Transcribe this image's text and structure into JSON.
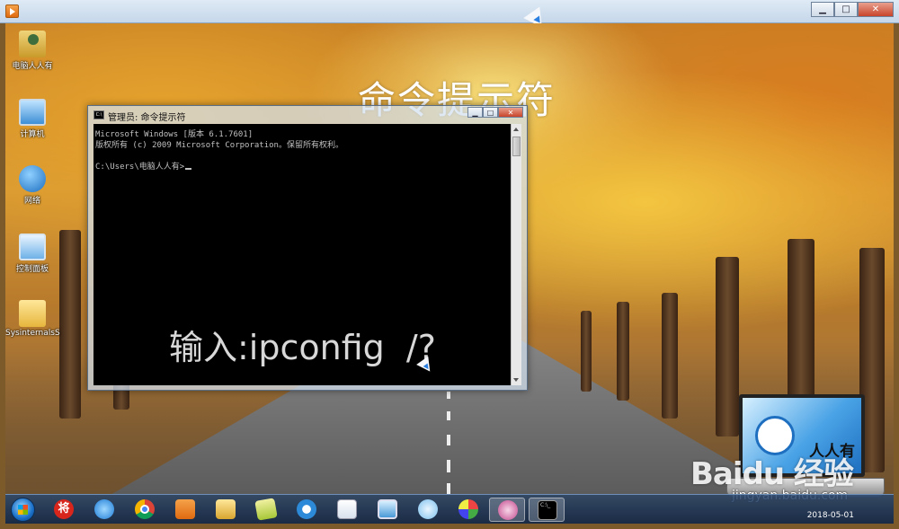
{
  "outer_window": {
    "minimize_symbol": "▁",
    "maximize_symbol": "□",
    "close_symbol": "✕"
  },
  "overlay": {
    "title": "命令提示符",
    "instruction": "输入:ipconfig  /?"
  },
  "desktop_icons": [
    {
      "label": "电脑人人有",
      "icon": "user-folder-icon"
    },
    {
      "label": "计算机",
      "icon": "computer-icon"
    },
    {
      "label": "网络",
      "icon": "network-icon"
    },
    {
      "label": "控制面板",
      "icon": "control-panel-icon"
    },
    {
      "label": "SysinternalsS",
      "icon": "folder-icon"
    }
  ],
  "cmd_window": {
    "title": "管理员: 命令提示符",
    "icon_text": "C:\\",
    "lines": [
      "Microsoft Windows [版本 6.1.7601]",
      "版权所有 (c) 2009 Microsoft Corporation。保留所有权利。",
      "",
      "C:\\Users\\电脑人人有>"
    ],
    "minimize_symbol": "▁",
    "maximize_symbol": "□",
    "close_symbol": "✕"
  },
  "logo": {
    "laptop_text": "人人有",
    "baidu_text": "Baidu 经验",
    "baidu_url": "jingyan.baidu.com"
  },
  "taskbar": {
    "jiang_label": "将",
    "console_label": "C:\\_",
    "clock_date": "2018-05-01",
    "items": [
      {
        "icon": "jiang-icon"
      },
      {
        "icon": "internet-explorer-icon"
      },
      {
        "icon": "chrome-icon"
      },
      {
        "icon": "media-player-icon"
      },
      {
        "icon": "file-explorer-icon"
      },
      {
        "icon": "sticky-notes-icon"
      },
      {
        "icon": "qq-browser-icon"
      },
      {
        "icon": "document-icon"
      },
      {
        "icon": "remote-desktop-icon"
      },
      {
        "icon": "star-app-icon"
      },
      {
        "icon": "paint-icon"
      },
      {
        "icon": "avatar-app-icon"
      },
      {
        "icon": "command-prompt-icon"
      }
    ]
  },
  "colors": {
    "console_bg": "#000000",
    "console_text": "#c0c0c0",
    "taskbar": "#1f3a5e"
  }
}
